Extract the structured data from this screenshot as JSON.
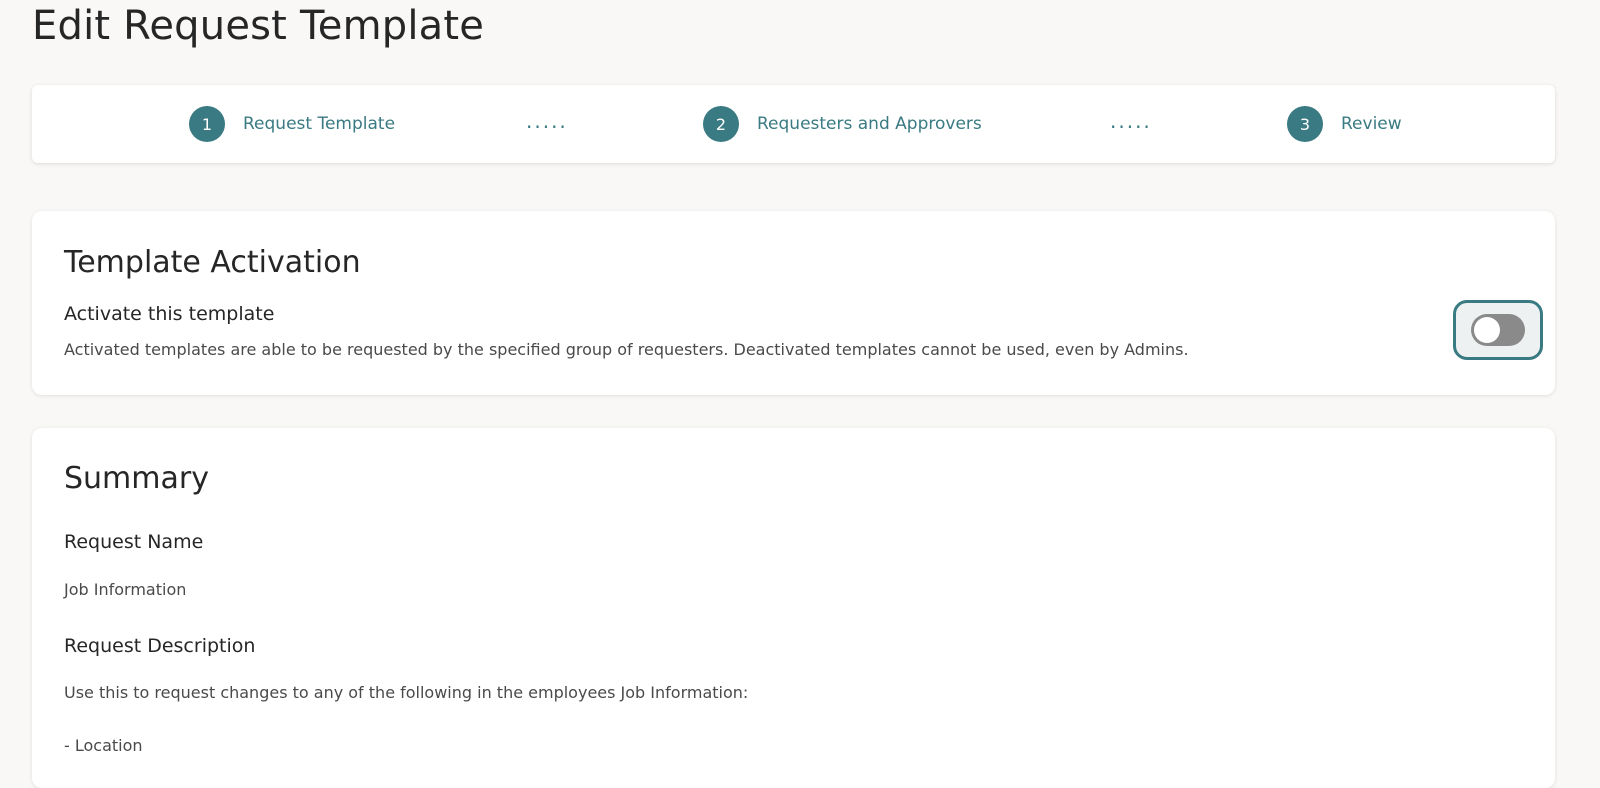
{
  "page": {
    "title": "Edit Request Template"
  },
  "stepper": {
    "steps": [
      {
        "number": "1",
        "label": "Request Template"
      },
      {
        "number": "2",
        "label": "Requesters and Approvers"
      },
      {
        "number": "3",
        "label": "Review"
      }
    ],
    "separator": "....."
  },
  "activation": {
    "title": "Template Activation",
    "label": "Activate this template",
    "description": "Activated templates are able to be requested by the specified group of requesters. Deactivated templates cannot be used, even by Admins.",
    "toggle_on": false
  },
  "summary": {
    "title": "Summary",
    "request_name_label": "Request Name",
    "request_name_value": "Job Information",
    "request_description_label": "Request Description",
    "request_description_line1": "Use this to request changes to any of the following in the employees Job Information:",
    "request_description_line2": "- Location"
  },
  "colors": {
    "accent": "#3a7a82",
    "background": "#f9f8f6"
  }
}
